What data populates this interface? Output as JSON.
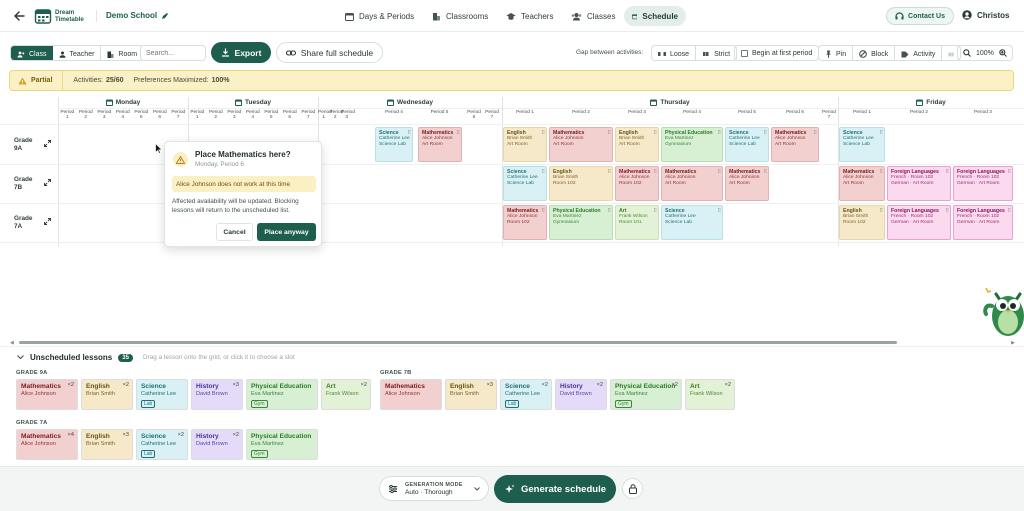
{
  "header": {
    "app_name_line1": "Dream",
    "app_name_line2": "Timetable",
    "school_name": "Demo School",
    "nav": [
      {
        "label": "Days & Periods",
        "icon": "calendar-icon"
      },
      {
        "label": "Classrooms",
        "icon": "building-icon"
      },
      {
        "label": "Teachers",
        "icon": "graduation-cap-icon"
      },
      {
        "label": "Classes",
        "icon": "users-icon"
      },
      {
        "label": "Schedule",
        "icon": "calendar-icon",
        "active": true
      }
    ],
    "contact_label": "Contact Us",
    "user_name": "Christos"
  },
  "toolbar": {
    "view_tabs": [
      {
        "label": "Class",
        "active": true
      },
      {
        "label": "Teacher"
      },
      {
        "label": "Room"
      }
    ],
    "search_placeholder": "Search...",
    "export_label": "Export",
    "share_label": "Share full schedule",
    "gap_label": "Gap between activities:",
    "loose_label": "Loose",
    "strict_label": "Strict",
    "begin_label": "Begin at first period",
    "pin_label": "Pin",
    "block_label": "Block",
    "activity_label": "Activity",
    "zoom": "100%"
  },
  "status": {
    "badge": "Partial",
    "activities_label": "Activities:",
    "activities_value": "25/60",
    "prefs_label": "Preferences Maximized:",
    "prefs_value": "100%"
  },
  "days": [
    "Monday",
    "Tuesday",
    "Wednesday",
    "Thursday",
    "Friday"
  ],
  "periods_short": {
    "monday": [
      {
        "a": "Period",
        "b": "1"
      },
      {
        "a": "Period",
        "b": "2"
      },
      {
        "a": "Period",
        "b": "3"
      },
      {
        "a": "Period",
        "b": "4"
      },
      {
        "a": "Period",
        "b": "5"
      },
      {
        "a": "Period",
        "b": "6"
      },
      {
        "a": "Period",
        "b": "7"
      }
    ],
    "tuesday": [
      {
        "a": "Period",
        "b": "1"
      },
      {
        "a": "Period",
        "b": "2"
      },
      {
        "a": "Period",
        "b": "3"
      },
      {
        "a": "Period",
        "b": "4"
      },
      {
        "a": "Period",
        "b": "5"
      },
      {
        "a": "Period",
        "b": "6"
      },
      {
        "a": "Period",
        "b": "7"
      }
    ],
    "wednesday": [
      {
        "a": "Period",
        "b": "1"
      },
      {
        "a": "Period",
        "b": "2"
      },
      {
        "a": "Period",
        "b": "3"
      },
      {
        "a": "Period 4",
        "b": ""
      },
      {
        "a": "Period 5",
        "b": ""
      },
      {
        "a": "Period",
        "b": "6"
      },
      {
        "a": "Period",
        "b": "7"
      }
    ],
    "thursday": [
      {
        "a": "Period 1",
        "b": ""
      },
      {
        "a": "Period 2",
        "b": ""
      },
      {
        "a": "Period 3",
        "b": ""
      },
      {
        "a": "Period 4",
        "b": ""
      },
      {
        "a": "Period 5",
        "b": ""
      },
      {
        "a": "Period 6",
        "b": ""
      },
      {
        "a": "Period",
        "b": "7"
      }
    ],
    "friday": [
      {
        "a": "Period 1",
        "b": ""
      },
      {
        "a": "Period 2",
        "b": ""
      },
      {
        "a": "Period 3",
        "b": ""
      }
    ]
  },
  "grades": [
    "Grade 9A",
    "Grade 7B",
    "Grade 7A"
  ],
  "cards": [
    {
      "row": 0,
      "day": "wednesday",
      "p": 3,
      "type": "sci",
      "title": "Science",
      "teacher": "Catherine Lee",
      "room": "Science Lab"
    },
    {
      "row": 0,
      "day": "wednesday",
      "p": 4,
      "type": "mat",
      "title": "Mathematics",
      "teacher": "Alice Johnson",
      "room": "Art Room"
    },
    {
      "row": 0,
      "day": "thursday",
      "p": 0,
      "type": "eng",
      "title": "English",
      "teacher": "Brian Smith",
      "room": "Art Room"
    },
    {
      "row": 0,
      "day": "thursday",
      "p": 1,
      "type": "mat",
      "title": "Mathematics",
      "teacher": "Alice Johnson",
      "room": "Art Room"
    },
    {
      "row": 0,
      "day": "thursday",
      "p": 2,
      "type": "eng",
      "title": "English",
      "teacher": "Brian Smith",
      "room": "Art Room"
    },
    {
      "row": 0,
      "day": "thursday",
      "p": 3,
      "type": "pe",
      "title": "Physical Education",
      "teacher": "Eva Martinez",
      "room": "Gymnasium"
    },
    {
      "row": 0,
      "day": "thursday",
      "p": 4,
      "type": "sci",
      "title": "Science",
      "teacher": "Catherine Lee",
      "room": "Science Lab"
    },
    {
      "row": 0,
      "day": "thursday",
      "p": 5,
      "type": "mat",
      "title": "Mathematics",
      "teacher": "Alice Johnson",
      "room": "Art Room"
    },
    {
      "row": 0,
      "day": "friday",
      "p": 0,
      "type": "sci",
      "title": "Science",
      "teacher": "Catherine Lee",
      "room": "Science Lab"
    },
    {
      "row": 1,
      "day": "thursday",
      "p": 0,
      "type": "sci",
      "title": "Science",
      "teacher": "Catherine Lee",
      "room": "Science Lab"
    },
    {
      "row": 1,
      "day": "thursday",
      "p": 1,
      "type": "eng",
      "title": "English",
      "teacher": "Brian Smith",
      "room": "Room 102"
    },
    {
      "row": 1,
      "day": "thursday",
      "p": 2,
      "type": "mat",
      "title": "Mathematics",
      "teacher": "Alice Johnson",
      "room": "Room 102"
    },
    {
      "row": 1,
      "day": "thursday",
      "p": 3,
      "type": "mat",
      "title": "Mathematics",
      "teacher": "Alice Johnson",
      "room": "Art Room"
    },
    {
      "row": 1,
      "day": "thursday",
      "p": 4,
      "type": "mat",
      "title": "Mathematics",
      "teacher": "Alice Johnson",
      "room": "Art Room"
    },
    {
      "row": 1,
      "day": "friday",
      "p": 0,
      "type": "mat",
      "title": "Mathematics",
      "teacher": "Alice Johnson",
      "room": "Art Room"
    },
    {
      "row": 1,
      "day": "friday",
      "p": 1,
      "type": "lang",
      "title": "Foreign Languages",
      "teacher": "French · Room 102",
      "room": "German · Art Room"
    },
    {
      "row": 1,
      "day": "friday",
      "p": 2,
      "type": "lang",
      "title": "Foreign Languages",
      "teacher": "French · Room 102",
      "room": "German · Art Room"
    },
    {
      "row": 2,
      "day": "thursday",
      "p": 0,
      "type": "mat",
      "title": "Mathematics",
      "teacher": "Alice Johnson",
      "room": "Room 102"
    },
    {
      "row": 2,
      "day": "thursday",
      "p": 1,
      "type": "pe",
      "title": "Physical Education",
      "teacher": "Eva Martinez",
      "room": "Gymnasium"
    },
    {
      "row": 2,
      "day": "thursday",
      "p": 2,
      "type": "art",
      "title": "Art",
      "teacher": "Frank Wilson",
      "room": "Room 101"
    },
    {
      "row": 2,
      "day": "thursday",
      "p": 3,
      "type": "sci",
      "title": "Science",
      "teacher": "Catherine Lee",
      "room": "Science Lab"
    },
    {
      "row": 2,
      "day": "friday",
      "p": 0,
      "type": "eng",
      "title": "English",
      "teacher": "Brian Smith",
      "room": "Room 102"
    },
    {
      "row": 2,
      "day": "friday",
      "p": 1,
      "type": "lang",
      "title": "Foreign Languages",
      "teacher": "French · Room 102",
      "room": "German · Art Room"
    },
    {
      "row": 2,
      "day": "friday",
      "p": 2,
      "type": "lang",
      "title": "Foreign Languages",
      "teacher": "French · Room 102",
      "room": "German · Art Room"
    }
  ],
  "popup": {
    "title": "Place Mathematics here?",
    "subtitle": "Monday, Period 6",
    "warning": "Alice Johnson does not work at this time",
    "body": "Affected availability will be updated. Blocking lessons will return to the unscheduled list.",
    "cancel": "Cancel",
    "confirm": "Place anyway"
  },
  "unscheduled": {
    "title": "Unscheduled lessons",
    "count": "35",
    "hint": "Drag a lesson onto the grid, or click it to choose a slot",
    "groups": [
      {
        "grade": "GRADE 9A",
        "items": [
          {
            "type": "mat",
            "title": "Mathematics",
            "teacher": "Alice Johnson",
            "count": "×2",
            "tag": ""
          },
          {
            "type": "eng",
            "title": "English",
            "teacher": "Brian Smith",
            "count": "×2",
            "tag": ""
          },
          {
            "type": "sci",
            "title": "Science",
            "teacher": "Catherine Lee",
            "count": "",
            "tag": "Lab"
          },
          {
            "type": "hist",
            "title": "History",
            "teacher": "David Brown",
            "count": "×3",
            "tag": ""
          },
          {
            "type": "pe",
            "title": "Physical Education",
            "teacher": "Eva Martinez",
            "count": "",
            "tag": "Gym"
          },
          {
            "type": "art",
            "title": "Art",
            "teacher": "Frank Wilson",
            "count": "×2",
            "tag": ""
          }
        ]
      },
      {
        "grade": "GRADE 7B",
        "items": [
          {
            "type": "mat",
            "title": "Mathematics",
            "teacher": "Alice Johnson",
            "count": "",
            "tag": ""
          },
          {
            "type": "eng",
            "title": "English",
            "teacher": "Brian Smith",
            "count": "×3",
            "tag": ""
          },
          {
            "type": "sci",
            "title": "Science",
            "teacher": "Catherine Lee",
            "count": "×2",
            "tag": "Lab"
          },
          {
            "type": "hist",
            "title": "History",
            "teacher": "David Brown",
            "count": "×2",
            "tag": ""
          },
          {
            "type": "pe",
            "title": "Physical Education",
            "teacher": "Eva Martinez",
            "count": "×2",
            "tag": "Gym"
          },
          {
            "type": "art",
            "title": "Art",
            "teacher": "Frank Wilson",
            "count": "×2",
            "tag": ""
          }
        ]
      },
      {
        "grade": "GRADE 7A",
        "items": [
          {
            "type": "mat",
            "title": "Mathematics",
            "teacher": "Alice Johnson",
            "count": "×4",
            "tag": ""
          },
          {
            "type": "eng",
            "title": "English",
            "teacher": "Brian Smith",
            "count": "×3",
            "tag": ""
          },
          {
            "type": "sci",
            "title": "Science",
            "teacher": "Catherine Lee",
            "count": "×2",
            "tag": "Lab"
          },
          {
            "type": "hist",
            "title": "History",
            "teacher": "David Brown",
            "count": "×2",
            "tag": ""
          },
          {
            "type": "pe",
            "title": "Physical Education",
            "teacher": "Eva Martinez",
            "count": "",
            "tag": "Gym"
          }
        ]
      }
    ]
  },
  "footer": {
    "mode_label": "GENERATION MODE",
    "mode_value": "Auto · Thorough",
    "generate_label": "Generate schedule"
  },
  "colors": {
    "primary": "#1d5e4e",
    "partial_bg": "#fbf1c6",
    "partial_border": "#f0d67a"
  }
}
